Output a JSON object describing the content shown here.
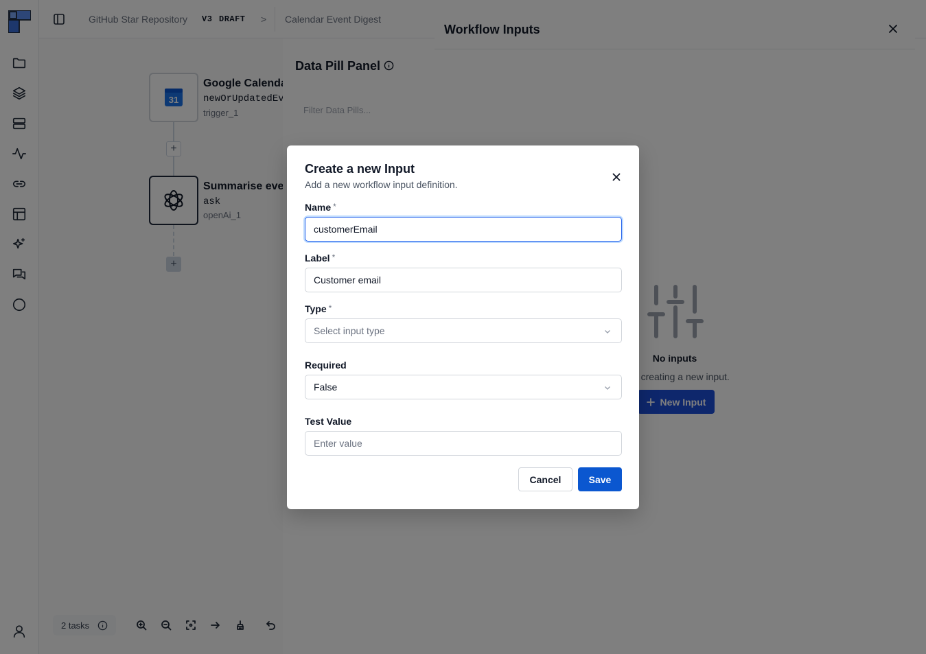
{
  "breadcrumb": {
    "project": "GitHub Star Repository",
    "version": "V3",
    "status": "DRAFT",
    "separator": ">",
    "workflow": "Calendar Event Digest"
  },
  "rail": {
    "icons": [
      "folder-icon",
      "layers-icon",
      "server-icon",
      "activity-icon",
      "link-icon",
      "table-icon",
      "sparkles-icon",
      "chat-icon",
      "circle-icon",
      "user-icon"
    ]
  },
  "canvas": {
    "nodes": [
      {
        "title": "Google Calenda",
        "operation": "newOrUpdatedEv",
        "id": "trigger_1",
        "icon": "google-calendar-icon",
        "icon_text": "31"
      },
      {
        "title": "Summarise eve",
        "operation": "ask",
        "id": "openAi_1",
        "icon": "openai-icon"
      }
    ],
    "add_label": "+"
  },
  "data_pill_panel": {
    "title": "Data Pill Panel",
    "filter_placeholder": "Filter Data Pills..."
  },
  "bottom_bar": {
    "tasks": "2 tasks"
  },
  "drawer": {
    "title": "Workflow Inputs",
    "empty_title": "No inputs",
    "empty_desc": "d by creating a new input.",
    "new_input_label": "New Input"
  },
  "modal": {
    "title": "Create a new Input",
    "description": "Add a new workflow input definition.",
    "required_mark": "*",
    "fields": {
      "name": {
        "label": "Name",
        "value": "customerEmail"
      },
      "label": {
        "label": "Label",
        "value": "Customer email"
      },
      "type": {
        "label": "Type",
        "placeholder": "Select input type"
      },
      "required": {
        "label": "Required",
        "value": "False"
      },
      "test_value": {
        "label": "Test Value",
        "placeholder": "Enter value"
      }
    },
    "cancel_label": "Cancel",
    "save_label": "Save"
  },
  "colors": {
    "primary": "#0b57d0",
    "overlay": "rgba(0,0,0,0.5)"
  }
}
